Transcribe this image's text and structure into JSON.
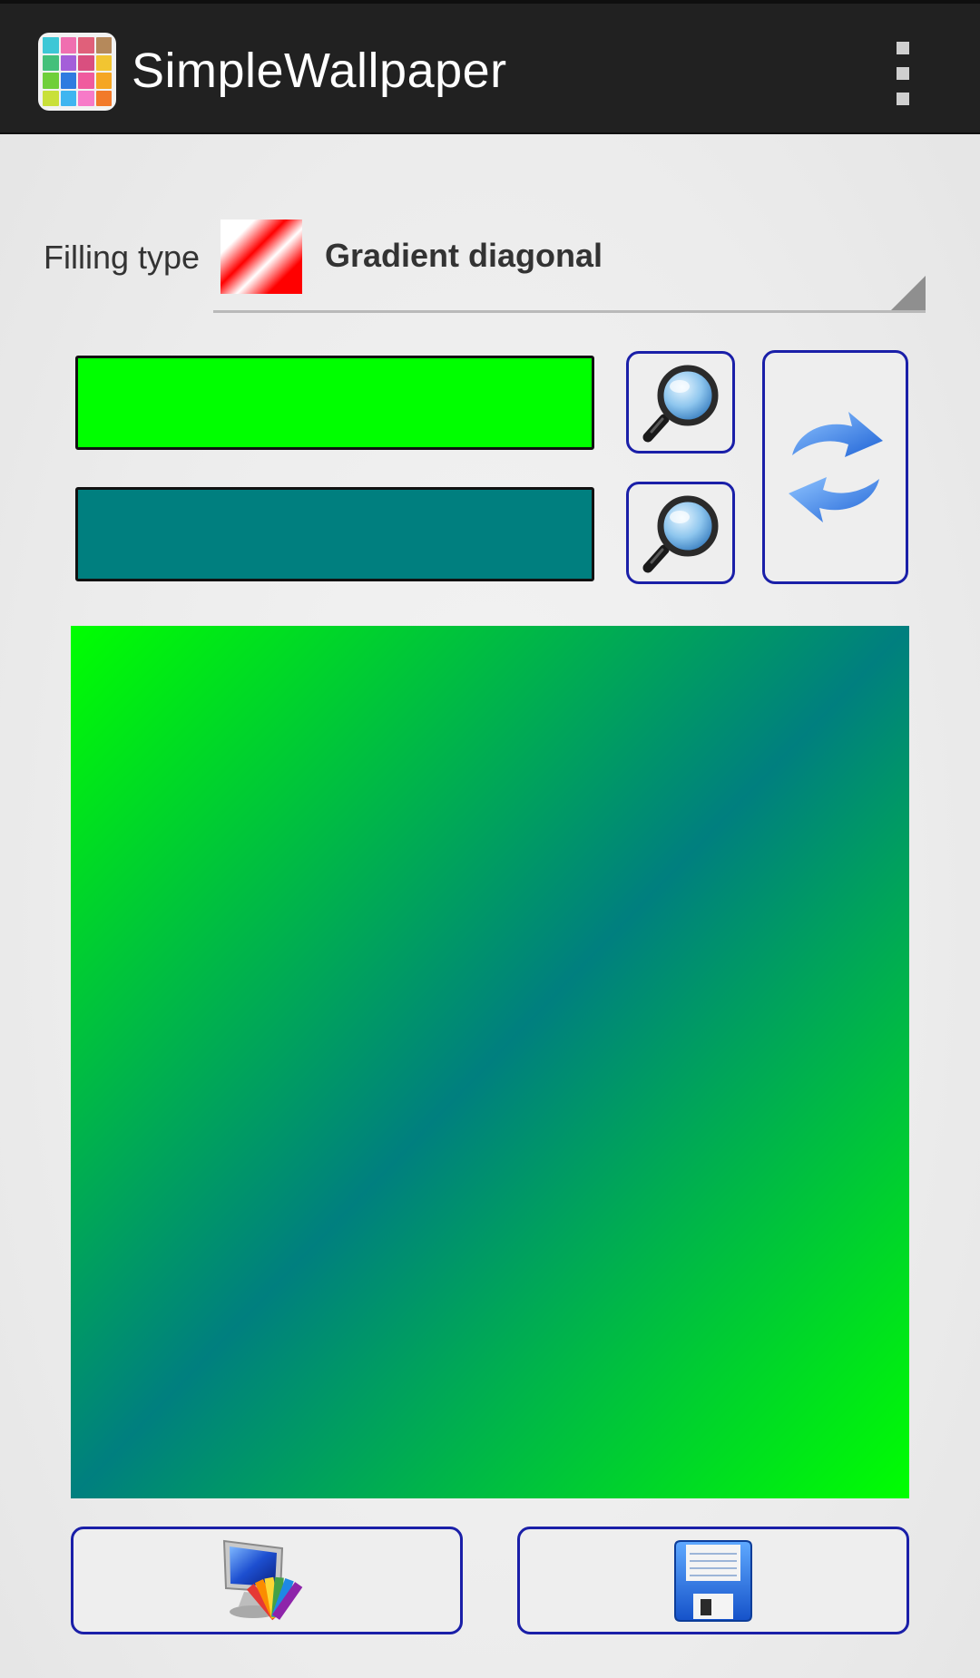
{
  "app": {
    "title": "SimpleWallpaper",
    "icon": "app-grid-icon",
    "menu_icon": "overflow-menu-icon",
    "icon_colors": [
      "#3cc7d6",
      "#f06fb0",
      "#e0607a",
      "#b5895b",
      "#44c07a",
      "#a45fd9",
      "#d94f7f",
      "#f2c531",
      "#6fcf3a",
      "#2f7be0",
      "#f05b9e",
      "#f5a623",
      "#c9e03a",
      "#3fb5f0",
      "#f77ac8",
      "#f27a2a"
    ]
  },
  "filling": {
    "label": "Filling type",
    "selected": "Gradient diagonal",
    "thumb_icon": "gradient-diagonal-thumbnail"
  },
  "colors": {
    "first": "#00ff00",
    "second": "#007f7f"
  },
  "buttons": {
    "pick_first_icon": "magnifier-icon",
    "pick_second_icon": "magnifier-icon",
    "swap_icon": "swap-arrows-icon",
    "set_wallpaper_icon": "monitor-palette-icon",
    "save_icon": "floppy-disk-icon"
  },
  "preview": {
    "type": "gradient-diagonal",
    "start_color": "#00ff00",
    "middle_color": "#007f7f",
    "end_color": "#00ff00"
  }
}
